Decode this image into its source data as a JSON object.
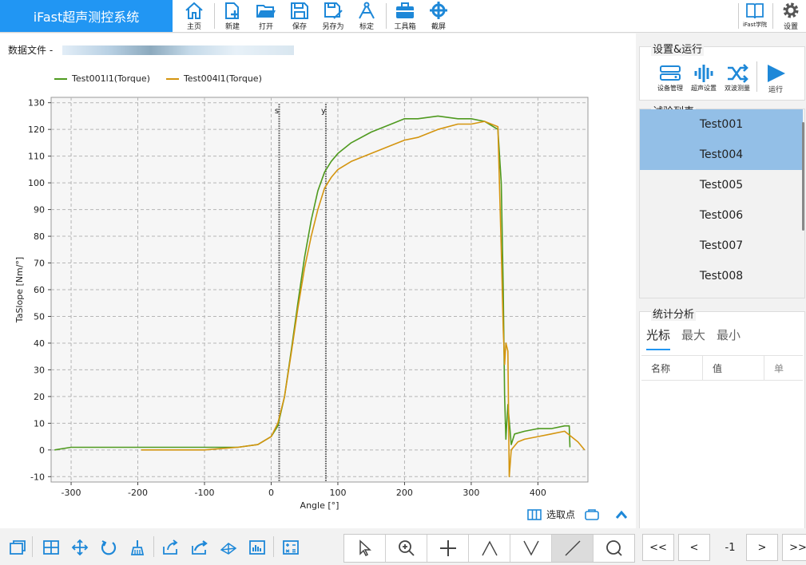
{
  "app": {
    "title": "iFast超声测控系统"
  },
  "toolbar": {
    "home": "主页",
    "new": "新建",
    "open": "打开",
    "save": "保存",
    "save_as": "另存为",
    "calibrate": "标定",
    "toolbox": "工具箱",
    "screenshot": "截屏",
    "academy": "iFast学院",
    "settings": "设置"
  },
  "main": {
    "data_file_label": "数据文件 -",
    "select_point": "选取点"
  },
  "chart_data": {
    "type": "line",
    "xlabel": "Angle [°]",
    "ylabel": "TaSlope [Nm/°]",
    "xlim": [
      -330,
      475
    ],
    "ylim": [
      -12,
      132
    ],
    "xticks": [
      -300,
      -200,
      -100,
      0,
      100,
      200,
      300,
      400
    ],
    "yticks": [
      -10,
      0,
      10,
      20,
      30,
      40,
      50,
      60,
      70,
      80,
      90,
      100,
      110,
      120,
      130
    ],
    "grid": true,
    "legend_position": "top-left",
    "markers": [
      {
        "label": "s",
        "x": 12
      },
      {
        "label": "y",
        "x": 82
      }
    ],
    "series": [
      {
        "name": "Test001l1(Torque)",
        "color": "#4f9a1f",
        "x": [
          -325,
          -300,
          -250,
          -200,
          -150,
          -100,
          -50,
          -20,
          0,
          10,
          20,
          30,
          40,
          50,
          60,
          70,
          80,
          90,
          100,
          120,
          150,
          180,
          200,
          220,
          250,
          280,
          300,
          320,
          340,
          345,
          348,
          350,
          352,
          355,
          360,
          365,
          380,
          400,
          420,
          440,
          447,
          448
        ],
        "y": [
          0,
          1,
          1,
          1,
          1,
          1,
          1,
          2,
          5,
          9,
          20,
          37,
          55,
          72,
          86,
          97,
          104,
          108,
          111,
          115,
          119,
          122,
          124,
          124,
          125,
          124,
          124,
          123,
          120,
          100,
          60,
          20,
          4,
          17,
          2,
          6,
          7,
          8,
          8,
          9,
          9,
          1
        ]
      },
      {
        "name": "Test004l1(Torque)",
        "color": "#d4950f",
        "x": [
          -195,
          -150,
          -100,
          -50,
          -20,
          0,
          10,
          20,
          30,
          40,
          50,
          60,
          70,
          80,
          90,
          100,
          120,
          150,
          180,
          200,
          220,
          250,
          280,
          300,
          320,
          340,
          345,
          348,
          350,
          352,
          355,
          357,
          360,
          370,
          380,
          400,
          420,
          440,
          460,
          470
        ],
        "y": [
          0,
          0,
          0,
          1,
          2,
          5,
          10,
          20,
          36,
          53,
          68,
          80,
          90,
          98,
          102,
          105,
          108,
          111,
          114,
          116,
          117,
          120,
          122,
          122,
          123,
          121,
          75,
          45,
          32,
          40,
          37,
          -10,
          0,
          3,
          4,
          5,
          6,
          7,
          3,
          0
        ]
      }
    ]
  },
  "settings_panel": {
    "title": "设置&运行",
    "device_mgmt": "设备管理",
    "ultrasonic_settings": "超声设置",
    "dual_wave": "双波测量",
    "run": "运行"
  },
  "test_list": {
    "title": "试验列表",
    "items": [
      "Test001",
      "Test004",
      "Test005",
      "Test006",
      "Test007",
      "Test008"
    ],
    "selected": [
      "Test001",
      "Test004"
    ]
  },
  "stats": {
    "title": "统计分析",
    "tabs": [
      "光标",
      "最大",
      "最小"
    ],
    "active_tab": "光标",
    "columns": [
      "名称",
      "值",
      "单"
    ]
  },
  "pager": {
    "first": "<<",
    "prev": "<",
    "page": "-1",
    "next": ">",
    "last": ">>"
  }
}
